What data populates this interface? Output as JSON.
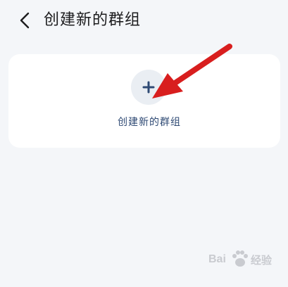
{
  "header": {
    "back_icon": "chevron-left-icon",
    "title": "创建新的群组"
  },
  "card": {
    "icon": "plus-icon",
    "label": "创建新的群组"
  },
  "annotation": {
    "icon": "red-arrow",
    "color": "#d81e1e"
  },
  "watermark": {
    "text_left": "Bai",
    "text_right": "经验",
    "icon": "paw-icon"
  },
  "colors": {
    "background": "#f4f6f9",
    "card": "#ffffff",
    "accent": "#2f4a74",
    "circle": "#eaeef3"
  }
}
